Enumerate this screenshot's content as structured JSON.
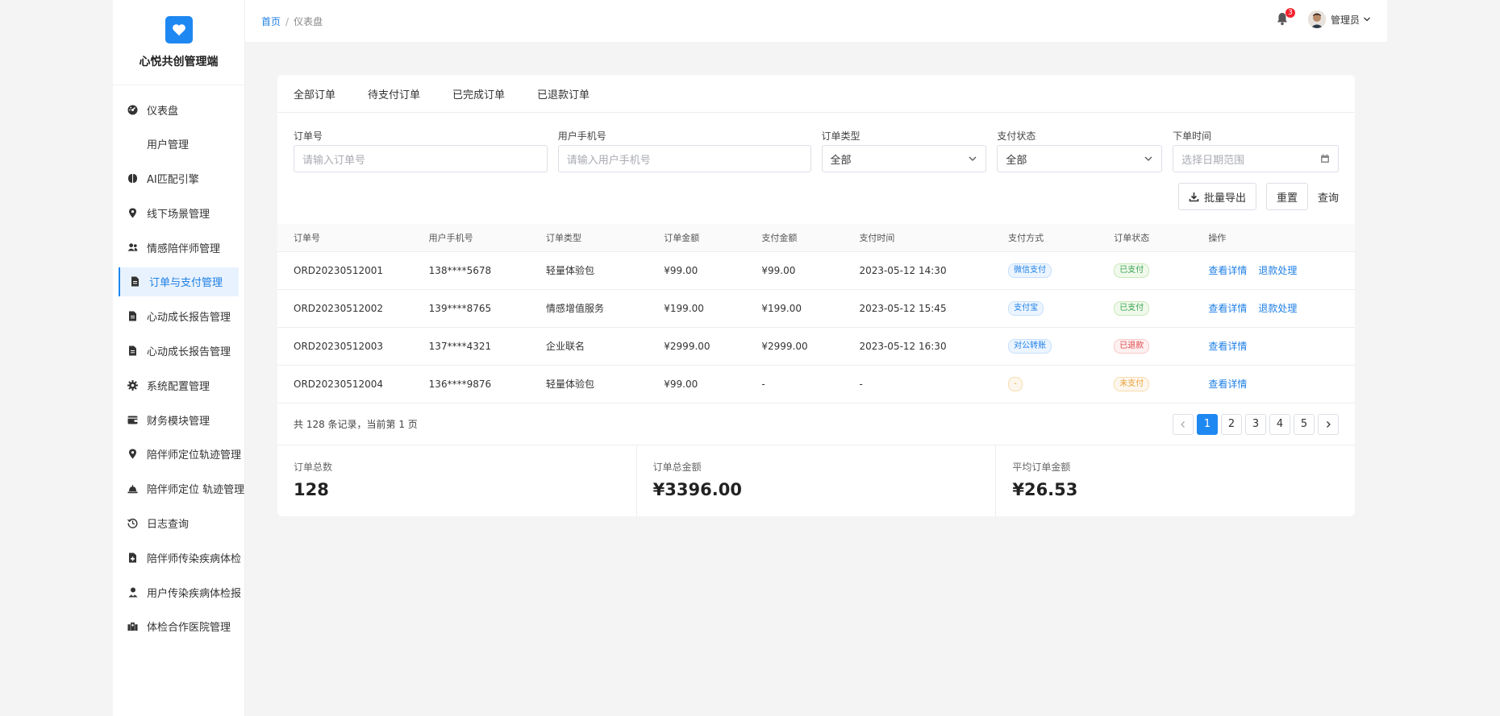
{
  "brand": {
    "name": "心悦共创管理端"
  },
  "sidebar": {
    "items": [
      {
        "label": "仪表盘",
        "icon": "dashboard-icon"
      },
      {
        "label": "用户管理",
        "icon": ""
      },
      {
        "label": "AI匹配引擎",
        "icon": "brain-icon"
      },
      {
        "label": "线下场景管理",
        "icon": "location-pin-icon"
      },
      {
        "label": "情感陪伴师管理",
        "icon": "users-icon"
      },
      {
        "label": "订单与支付管理",
        "icon": "file-icon",
        "active": true
      },
      {
        "label": "心动成长报告管理",
        "icon": "file-icon"
      },
      {
        "label": "心动成长报告管理",
        "icon": "file-icon"
      },
      {
        "label": "系统配置管理",
        "icon": "gear-icon"
      },
      {
        "label": "财务模块管理",
        "icon": "wallet-icon"
      },
      {
        "label": "陪伴师定位轨迹管理",
        "icon": "location-pin-icon"
      },
      {
        "label": "陪伴师定位 轨迹管理",
        "icon": "bell-alarm-icon"
      },
      {
        "label": "日志查询",
        "icon": "history-icon"
      },
      {
        "label": "陪伴师传染疾病体检",
        "icon": "file-medical-icon"
      },
      {
        "label": "用户传染疾病体检报",
        "icon": "user-doctor-icon"
      },
      {
        "label": "体检合作医院管理",
        "icon": "hospital-icon"
      }
    ]
  },
  "breadcrumb": {
    "home": "首页",
    "sep": "/",
    "current": "仪表盘"
  },
  "topbar": {
    "notification_count": "3",
    "user_name": "管理员"
  },
  "tabs": [
    "全部订单",
    "待支付订单",
    "已完成订单",
    "已退款订单"
  ],
  "filters": {
    "order_no": {
      "label": "订单号",
      "placeholder": "请输入订单号"
    },
    "phone": {
      "label": "用户手机号",
      "placeholder": "请输入用户手机号"
    },
    "type": {
      "label": "订单类型",
      "value": "全部"
    },
    "pay_status": {
      "label": "支付状态",
      "value": "全部"
    },
    "date": {
      "label": "下单时间",
      "placeholder": "选择日期范围"
    }
  },
  "actions": {
    "export": "批量导出",
    "reset": "重置",
    "query": "查询"
  },
  "table": {
    "headers": [
      "订单号",
      "用户手机号",
      "订单类型",
      "订单金额",
      "支付金额",
      "支付时间",
      "支付方式",
      "订单状态",
      "操作"
    ],
    "rows": [
      {
        "order_no": "ORD20230512001",
        "phone": "138****5678",
        "type": "轻量体验包",
        "amount": "¥99.00",
        "paid": "¥99.00",
        "time": "2023-05-12 14:30",
        "method": "微信支付",
        "method_color": "blue",
        "status": "已支付",
        "status_color": "green",
        "ops": [
          "查看详情",
          "退款处理"
        ]
      },
      {
        "order_no": "ORD20230512002",
        "phone": "139****8765",
        "type": "情感增值服务",
        "amount": "¥199.00",
        "paid": "¥199.00",
        "time": "2023-05-12 15:45",
        "method": "支付宝",
        "method_color": "blue",
        "status": "已支付",
        "status_color": "green",
        "ops": [
          "查看详情",
          "退款处理"
        ]
      },
      {
        "order_no": "ORD20230512003",
        "phone": "137****4321",
        "type": "企业联名",
        "amount": "¥2999.00",
        "paid": "¥2999.00",
        "time": "2023-05-12 16:30",
        "method": "对公转账",
        "method_color": "blue",
        "status": "已退款",
        "status_color": "red",
        "ops": [
          "查看详情"
        ]
      },
      {
        "order_no": "ORD20230512004",
        "phone": "136****9876",
        "type": "轻量体验包",
        "amount": "¥99.00",
        "paid": "-",
        "time": "-",
        "method": "-",
        "method_color": "orange",
        "status": "未支付",
        "status_color": "orange",
        "ops": [
          "查看详情"
        ]
      }
    ]
  },
  "pagination": {
    "summary": "共 128 条记录，当前第 1 页",
    "pages": [
      "1",
      "2",
      "3",
      "4",
      "5"
    ],
    "current": "1"
  },
  "stats": [
    {
      "label": "订单总数",
      "value": "128"
    },
    {
      "label": "订单总金额",
      "value": "¥3396.00"
    },
    {
      "label": "平均订单金额",
      "value": "¥26.53"
    }
  ],
  "colors": {
    "primary": "#1e88f2",
    "success": "#33a14c",
    "danger": "#e1474b",
    "warning": "#e6a23c"
  }
}
